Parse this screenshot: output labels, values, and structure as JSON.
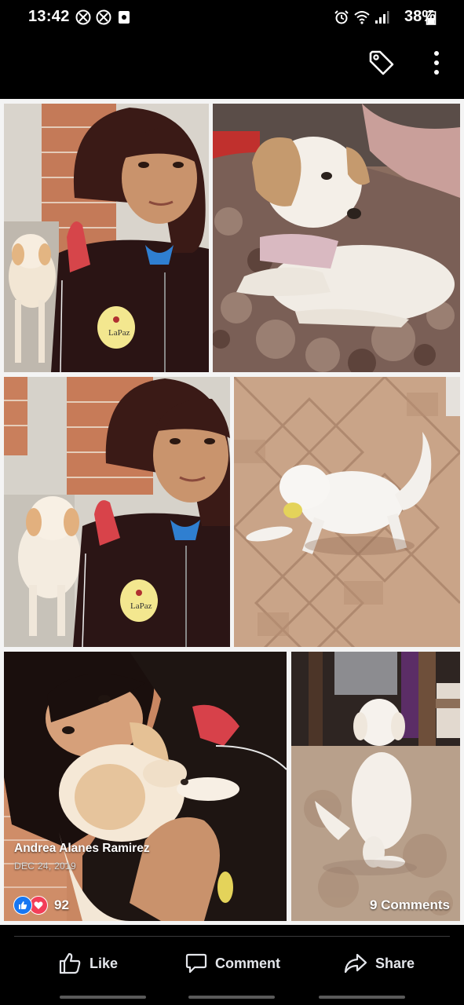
{
  "status_bar": {
    "time": "13:42",
    "battery": "38%",
    "icons": [
      "notification-icon",
      "notification-icon",
      "app-notification-icon",
      "alarm-icon",
      "wifi-icon",
      "signal-icon",
      "battery-icon"
    ]
  },
  "top_bar": {
    "icons": [
      "tag-icon",
      "more-vertical-icon"
    ]
  },
  "photos": [
    {
      "name": "photo-girl-with-puppy-wall"
    },
    {
      "name": "photo-puppy-on-blanket"
    },
    {
      "name": "photo-girl-with-puppy-sitting"
    },
    {
      "name": "photo-puppy-on-tiles"
    },
    {
      "name": "photo-girl-hugging-puppy"
    },
    {
      "name": "photo-puppy-from-behind"
    }
  ],
  "post": {
    "author": "Andrea Alanes Ramirez",
    "date": "DEC 24, 2019",
    "reaction_count": "92",
    "reactions": [
      "like-reaction-icon",
      "love-reaction-icon"
    ],
    "comments": "9 Comments"
  },
  "actions": {
    "like": "Like",
    "comment": "Comment",
    "share": "Share"
  }
}
